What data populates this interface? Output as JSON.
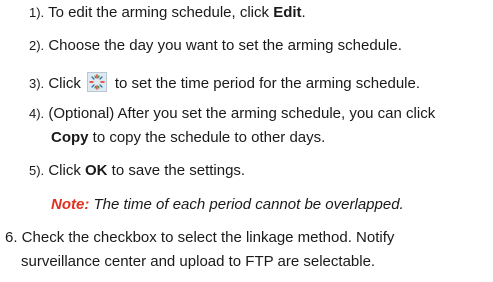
{
  "steps": [
    {
      "num": "1).",
      "pre": " To edit the arming schedule, click ",
      "bold": "Edit",
      "post": "."
    },
    {
      "num": "2).",
      "text": " Choose the day you want to set the arming schedule."
    },
    {
      "num": "3).",
      "pre": " Click",
      "icon": "schedule-clock-icon",
      "post": "to set the time period for the arming schedule."
    },
    {
      "num": "4).",
      "line1": " (Optional) After you set the arming schedule, you can click",
      "bold": "Copy",
      "line2": " to copy the schedule to other days."
    },
    {
      "num": "5).",
      "pre": " Click ",
      "bold": "OK",
      "post": " to save the settings."
    }
  ],
  "note": {
    "label": "Note:",
    "text": " The time of each period cannot be overlapped."
  },
  "item6": {
    "line1": "6. Check the checkbox to select the linkage method. Notify",
    "line2": "surveillance center and upload to FTP are selectable."
  },
  "colors": {
    "note_label": "#e0301e",
    "text": "#1a1a1a"
  }
}
